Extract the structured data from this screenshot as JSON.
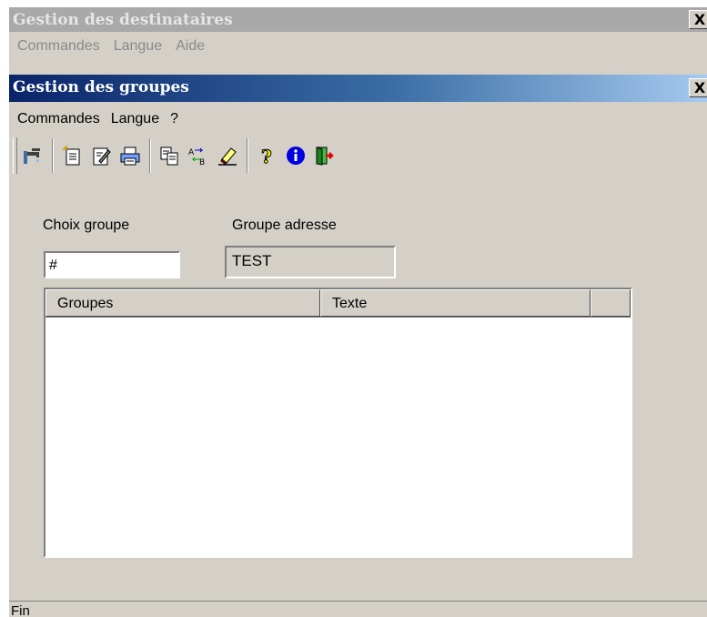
{
  "outer_window": {
    "title": "Gestion des destinataires",
    "close_label": "X",
    "menu": [
      "Commandes",
      "Langue",
      "Aide"
    ]
  },
  "inner_window": {
    "title": "Gestion des groupes",
    "close_label": "X",
    "menu": [
      "Commandes",
      "Langue",
      "?"
    ]
  },
  "toolbar": {
    "icons": [
      "tap-icon",
      "new-icon",
      "edit-icon",
      "print-icon",
      "copy-icon",
      "move-icon",
      "eraser-icon",
      "help-icon",
      "info-icon",
      "exit-icon"
    ]
  },
  "form": {
    "choix_groupe_label": "Choix groupe",
    "choix_groupe_value": "#",
    "groupe_adresse_label": "Groupe adresse",
    "groupe_adresse_value": "TEST"
  },
  "list": {
    "columns": [
      "Groupes",
      "Texte",
      ""
    ],
    "rows": []
  },
  "status_bar": {
    "text": "Fin"
  },
  "colors": {
    "face": "#d4d0c8",
    "active_title_start": "#0a246a",
    "active_title_end": "#a6caf0",
    "inactive_title": "#a9a9a9"
  }
}
